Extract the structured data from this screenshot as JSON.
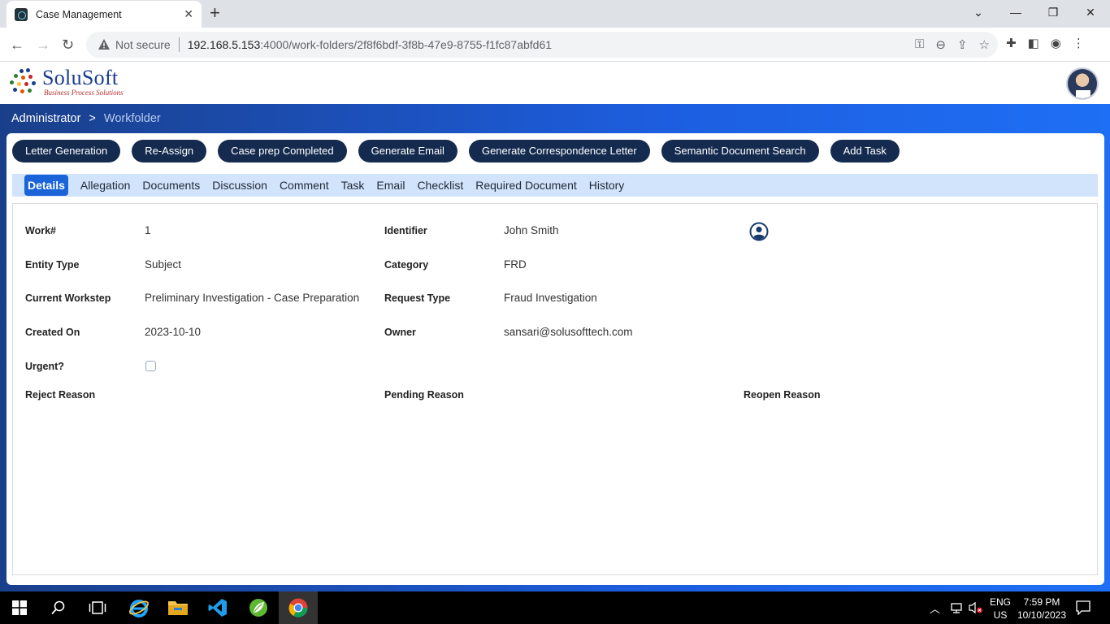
{
  "browser": {
    "tab_title": "Case Management",
    "security_label": "Not secure",
    "url_host": "192.168.5.153",
    "url_path": ":4000/work-folders/2f8f6bdf-3f8b-47e9-8755-f1fc87abfd61"
  },
  "logo": {
    "name": "SoluSoft",
    "tagline": "Business Process Solutions"
  },
  "breadcrumb": {
    "root": "Administrator",
    "separator": ">",
    "current": "Workfolder"
  },
  "actions": [
    "Letter Generation",
    "Re-Assign",
    "Case prep Completed",
    "Generate Email",
    "Generate Correspondence Letter",
    "Semantic Document Search",
    "Add Task"
  ],
  "tabs": [
    "Details",
    "Allegation",
    "Documents",
    "Discussion",
    "Comment",
    "Task",
    "Email",
    "Checklist",
    "Required Document",
    "History"
  ],
  "active_tab": "Details",
  "details": {
    "work_label": "Work#",
    "work_value": "1",
    "entity_label": "Entity Type",
    "entity_value": "Subject",
    "workstep_label": "Current Workstep",
    "workstep_value": "Preliminary Investigation - Case Preparation",
    "created_label": "Created On",
    "created_value": "2023-10-10",
    "urgent_label": "Urgent?",
    "urgent_checked": false,
    "reject_label": "Reject Reason",
    "identifier_label": "Identifier",
    "identifier_value": "John Smith",
    "category_label": "Category",
    "category_value": "FRD",
    "request_label": "Request Type",
    "request_value": "Fraud Investigation",
    "owner_label": "Owner",
    "owner_value": "sansari@solusofttech.com",
    "pending_label": "Pending Reason",
    "reopen_label": "Reopen Reason"
  },
  "taskbar": {
    "lang_top": "ENG",
    "lang_bottom": "US",
    "time": "7:59 PM",
    "date": "10/10/2023"
  },
  "colors": {
    "action_pill": "#152a4f",
    "active_tab": "#1a63d9",
    "tab_strip": "#d2e3fc",
    "band_start": "#1a3f8a",
    "band_end": "#1e6ff5"
  }
}
